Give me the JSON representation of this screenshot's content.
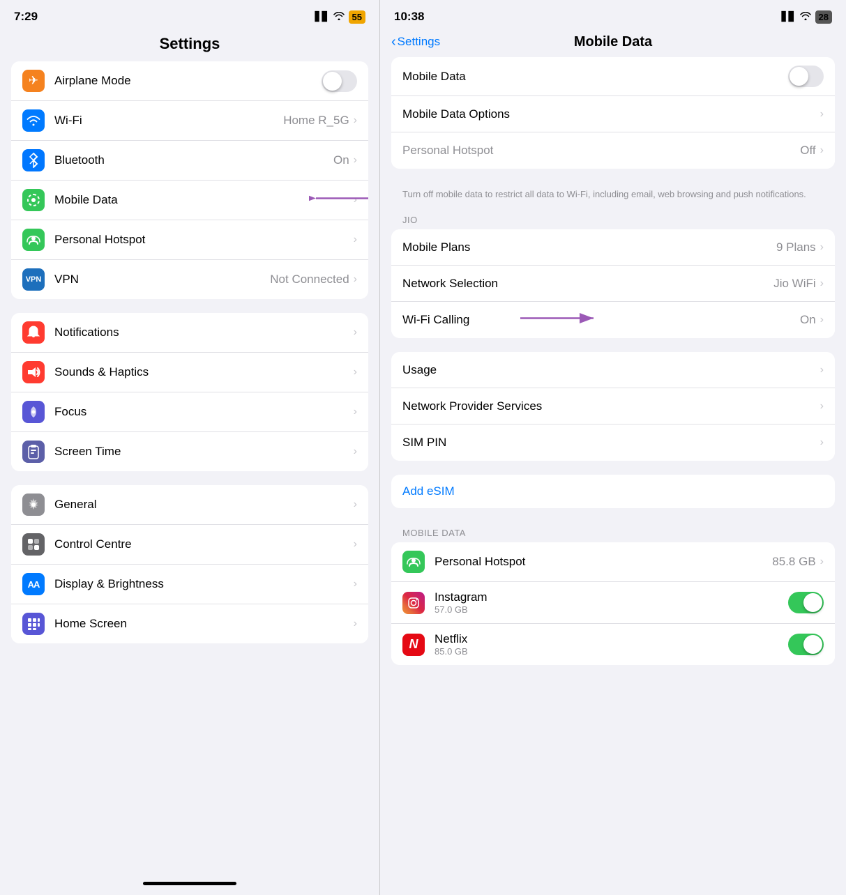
{
  "left": {
    "statusBar": {
      "time": "7:29",
      "battery": "55",
      "batteryColor": "#f0a500"
    },
    "title": "Settings",
    "groups": [
      {
        "id": "connectivity",
        "rows": [
          {
            "id": "airplane",
            "icon": "✈",
            "iconClass": "icon-orange",
            "label": "Airplane Mode",
            "valueType": "toggle",
            "toggleOn": false
          },
          {
            "id": "wifi",
            "icon": "wifi",
            "iconClass": "icon-blue",
            "label": "Wi-Fi",
            "value": "Home R_5G",
            "hasChevron": true
          },
          {
            "id": "bluetooth",
            "icon": "bluetooth",
            "iconClass": "icon-blue-dark",
            "label": "Bluetooth",
            "value": "On",
            "hasChevron": true
          },
          {
            "id": "mobiledata",
            "icon": "signal",
            "iconClass": "icon-green",
            "label": "Mobile Data",
            "hasChevron": true,
            "hasArrow": true
          },
          {
            "id": "hotspot",
            "icon": "link",
            "iconClass": "icon-green",
            "label": "Personal Hotspot",
            "hasChevron": true
          },
          {
            "id": "vpn",
            "icon": "VPN",
            "iconClass": "icon-vpn",
            "label": "VPN",
            "value": "Not Connected",
            "hasChevron": true
          }
        ]
      },
      {
        "id": "system",
        "rows": [
          {
            "id": "notifications",
            "icon": "bell",
            "iconClass": "icon-red",
            "label": "Notifications",
            "hasChevron": true
          },
          {
            "id": "sounds",
            "icon": "speaker",
            "iconClass": "icon-red-sound",
            "label": "Sounds & Haptics",
            "hasChevron": true
          },
          {
            "id": "focus",
            "icon": "moon",
            "iconClass": "icon-purple",
            "label": "Focus",
            "hasChevron": true
          },
          {
            "id": "screentime",
            "icon": "hourglass",
            "iconClass": "icon-indigo",
            "label": "Screen Time",
            "hasChevron": true
          }
        ]
      },
      {
        "id": "general",
        "rows": [
          {
            "id": "general-item",
            "icon": "gear",
            "iconClass": "icon-gray",
            "label": "General",
            "hasChevron": true
          },
          {
            "id": "controlcentre",
            "icon": "sliders",
            "iconClass": "icon-gray-dark",
            "label": "Control Centre",
            "hasChevron": true
          },
          {
            "id": "displaybrightness",
            "icon": "AA",
            "iconClass": "icon-blue-aa",
            "label": "Display & Brightness",
            "hasChevron": true
          },
          {
            "id": "homescreen",
            "icon": "grid",
            "iconClass": "icon-purple-home",
            "label": "Home Screen",
            "hasChevron": true
          }
        ]
      }
    ],
    "homeIndicator": true
  },
  "right": {
    "statusBar": {
      "time": "10:38",
      "battery": "28",
      "batteryColor": "#555"
    },
    "backLabel": "Settings",
    "title": "Mobile Data",
    "topGroup": [
      {
        "id": "mobiledata-toggle",
        "label": "Mobile Data",
        "valueType": "toggle",
        "toggleOn": false
      },
      {
        "id": "mobiledataoptions",
        "label": "Mobile Data Options",
        "hasChevron": true
      },
      {
        "id": "personalhotspot",
        "label": "Personal Hotspot",
        "value": "Off",
        "hasChevron": true,
        "grayLabel": true
      }
    ],
    "infoText": "Turn off mobile data to restrict all data to Wi-Fi, including email, web browsing and push notifications.",
    "jioLabel": "JIO",
    "jioGroup": [
      {
        "id": "mobileplans",
        "label": "Mobile Plans",
        "value": "9 Plans",
        "hasChevron": true
      },
      {
        "id": "networkselection",
        "label": "Network Selection",
        "value": "Jio WiFi",
        "hasChevron": true
      },
      {
        "id": "wificalling",
        "label": "Wi-Fi Calling",
        "value": "On",
        "hasChevron": true,
        "hasArrow": true
      }
    ],
    "moreGroup": [
      {
        "id": "usage",
        "label": "Usage",
        "hasChevron": true
      },
      {
        "id": "networkprovider",
        "label": "Network Provider Services",
        "hasChevron": true
      },
      {
        "id": "simpin",
        "label": "SIM PIN",
        "hasChevron": true
      }
    ],
    "addEsim": "Add eSIM",
    "mobileDataLabel": "MOBILE DATA",
    "mobileDataApps": [
      {
        "id": "personalhotspot-app",
        "icon": "link",
        "iconClass": "icon-green",
        "label": "Personal Hotspot",
        "value": "85.8 GB",
        "hasChevron": true
      },
      {
        "id": "instagram",
        "icon": "instagram",
        "iconClass": "instagram-icon",
        "label": "Instagram",
        "subLabel": "57.0 GB",
        "valueType": "toggle-green"
      },
      {
        "id": "netflix",
        "icon": "N",
        "iconClass": "netflix-icon",
        "label": "Netflix",
        "subLabel": "85.0 GB",
        "valueType": "toggle-green"
      }
    ]
  }
}
